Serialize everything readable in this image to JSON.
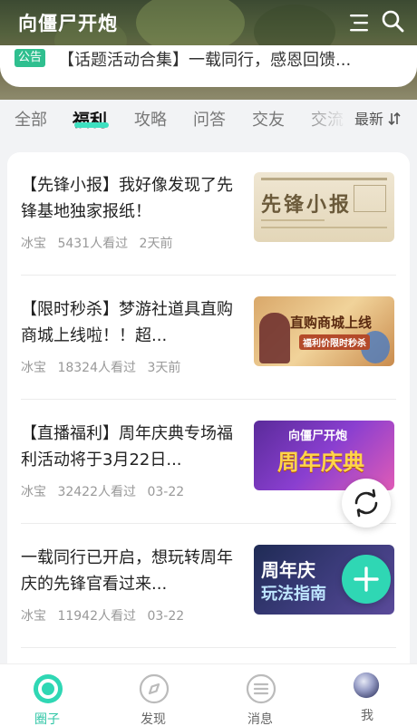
{
  "app": {
    "title": "向僵尸开炮"
  },
  "notice": {
    "badge": "公告",
    "text": "【话题活动合集】一载同行，感恩回馈..."
  },
  "tabs": [
    {
      "label": "全部"
    },
    {
      "label": "福利"
    },
    {
      "label": "攻略"
    },
    {
      "label": "问答"
    },
    {
      "label": "交友"
    },
    {
      "label": "交流"
    }
  ],
  "active_tab": "福利",
  "sort": {
    "label": "最新"
  },
  "posts": [
    {
      "title": "【先锋小报】我好像发现了先锋基地独家报纸！",
      "author": "冰宝",
      "views": "5431人看过",
      "time": "2天前",
      "thumb_text": "先锋小报"
    },
    {
      "title": "【限时秒杀】梦游社道具直购商城上线啦！！超...",
      "author": "冰宝",
      "views": "18324人看过",
      "time": "3天前",
      "thumb_text": "直购商城上线",
      "thumb_sub": "福利价限时秒杀"
    },
    {
      "title": "【直播福利】周年庆典专场福利活动将于3月22日...",
      "author": "冰宝",
      "views": "32422人看过",
      "time": "03-22",
      "thumb_text": "周年庆典",
      "thumb_top": "向僵尸开炮"
    },
    {
      "title": "一载同行已开启，想玩转周年庆的先锋官看过来...",
      "author": "冰宝",
      "views": "11942人看过",
      "time": "03-22",
      "thumb_text": "周年庆",
      "thumb_sub": "玩法指南"
    }
  ],
  "bottom_nav": [
    {
      "label": "圈子",
      "icon": "circle-icon"
    },
    {
      "label": "发现",
      "icon": "compass-icon"
    },
    {
      "label": "消息",
      "icon": "message-icon"
    },
    {
      "label": "我",
      "icon": "avatar"
    }
  ],
  "colors": {
    "accent": "#2fd7b4",
    "badge": "#2fbf8f"
  }
}
